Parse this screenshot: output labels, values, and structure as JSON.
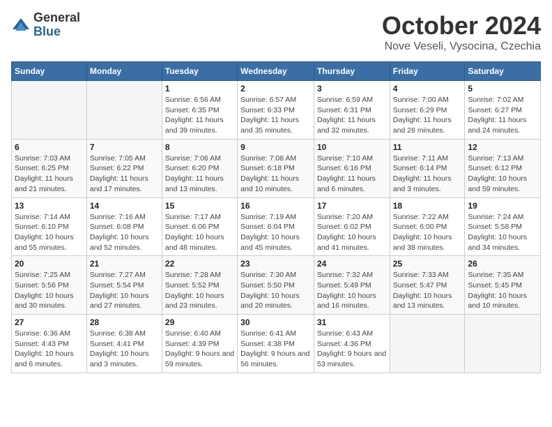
{
  "logo": {
    "general": "General",
    "blue": "Blue"
  },
  "title": "October 2024",
  "location": "Nove Veseli, Vysocina, Czechia",
  "days_header": [
    "Sunday",
    "Monday",
    "Tuesday",
    "Wednesday",
    "Thursday",
    "Friday",
    "Saturday"
  ],
  "weeks": [
    [
      {
        "day": "",
        "info": ""
      },
      {
        "day": "",
        "info": ""
      },
      {
        "day": "1",
        "info": "Sunrise: 6:56 AM\nSunset: 6:35 PM\nDaylight: 11 hours and 39 minutes."
      },
      {
        "day": "2",
        "info": "Sunrise: 6:57 AM\nSunset: 6:33 PM\nDaylight: 11 hours and 35 minutes."
      },
      {
        "day": "3",
        "info": "Sunrise: 6:59 AM\nSunset: 6:31 PM\nDaylight: 11 hours and 32 minutes."
      },
      {
        "day": "4",
        "info": "Sunrise: 7:00 AM\nSunset: 6:29 PM\nDaylight: 11 hours and 28 minutes."
      },
      {
        "day": "5",
        "info": "Sunrise: 7:02 AM\nSunset: 6:27 PM\nDaylight: 11 hours and 24 minutes."
      }
    ],
    [
      {
        "day": "6",
        "info": "Sunrise: 7:03 AM\nSunset: 6:25 PM\nDaylight: 11 hours and 21 minutes."
      },
      {
        "day": "7",
        "info": "Sunrise: 7:05 AM\nSunset: 6:22 PM\nDaylight: 11 hours and 17 minutes."
      },
      {
        "day": "8",
        "info": "Sunrise: 7:06 AM\nSunset: 6:20 PM\nDaylight: 11 hours and 13 minutes."
      },
      {
        "day": "9",
        "info": "Sunrise: 7:08 AM\nSunset: 6:18 PM\nDaylight: 11 hours and 10 minutes."
      },
      {
        "day": "10",
        "info": "Sunrise: 7:10 AM\nSunset: 6:16 PM\nDaylight: 11 hours and 6 minutes."
      },
      {
        "day": "11",
        "info": "Sunrise: 7:11 AM\nSunset: 6:14 PM\nDaylight: 11 hours and 3 minutes."
      },
      {
        "day": "12",
        "info": "Sunrise: 7:13 AM\nSunset: 6:12 PM\nDaylight: 10 hours and 59 minutes."
      }
    ],
    [
      {
        "day": "13",
        "info": "Sunrise: 7:14 AM\nSunset: 6:10 PM\nDaylight: 10 hours and 55 minutes."
      },
      {
        "day": "14",
        "info": "Sunrise: 7:16 AM\nSunset: 6:08 PM\nDaylight: 10 hours and 52 minutes."
      },
      {
        "day": "15",
        "info": "Sunrise: 7:17 AM\nSunset: 6:06 PM\nDaylight: 10 hours and 48 minutes."
      },
      {
        "day": "16",
        "info": "Sunrise: 7:19 AM\nSunset: 6:04 PM\nDaylight: 10 hours and 45 minutes."
      },
      {
        "day": "17",
        "info": "Sunrise: 7:20 AM\nSunset: 6:02 PM\nDaylight: 10 hours and 41 minutes."
      },
      {
        "day": "18",
        "info": "Sunrise: 7:22 AM\nSunset: 6:00 PM\nDaylight: 10 hours and 38 minutes."
      },
      {
        "day": "19",
        "info": "Sunrise: 7:24 AM\nSunset: 5:58 PM\nDaylight: 10 hours and 34 minutes."
      }
    ],
    [
      {
        "day": "20",
        "info": "Sunrise: 7:25 AM\nSunset: 5:56 PM\nDaylight: 10 hours and 30 minutes."
      },
      {
        "day": "21",
        "info": "Sunrise: 7:27 AM\nSunset: 5:54 PM\nDaylight: 10 hours and 27 minutes."
      },
      {
        "day": "22",
        "info": "Sunrise: 7:28 AM\nSunset: 5:52 PM\nDaylight: 10 hours and 23 minutes."
      },
      {
        "day": "23",
        "info": "Sunrise: 7:30 AM\nSunset: 5:50 PM\nDaylight: 10 hours and 20 minutes."
      },
      {
        "day": "24",
        "info": "Sunrise: 7:32 AM\nSunset: 5:49 PM\nDaylight: 10 hours and 16 minutes."
      },
      {
        "day": "25",
        "info": "Sunrise: 7:33 AM\nSunset: 5:47 PM\nDaylight: 10 hours and 13 minutes."
      },
      {
        "day": "26",
        "info": "Sunrise: 7:35 AM\nSunset: 5:45 PM\nDaylight: 10 hours and 10 minutes."
      }
    ],
    [
      {
        "day": "27",
        "info": "Sunrise: 6:36 AM\nSunset: 4:43 PM\nDaylight: 10 hours and 6 minutes."
      },
      {
        "day": "28",
        "info": "Sunrise: 6:38 AM\nSunset: 4:41 PM\nDaylight: 10 hours and 3 minutes."
      },
      {
        "day": "29",
        "info": "Sunrise: 6:40 AM\nSunset: 4:39 PM\nDaylight: 9 hours and 59 minutes."
      },
      {
        "day": "30",
        "info": "Sunrise: 6:41 AM\nSunset: 4:38 PM\nDaylight: 9 hours and 56 minutes."
      },
      {
        "day": "31",
        "info": "Sunrise: 6:43 AM\nSunset: 4:36 PM\nDaylight: 9 hours and 53 minutes."
      },
      {
        "day": "",
        "info": ""
      },
      {
        "day": "",
        "info": ""
      }
    ]
  ]
}
